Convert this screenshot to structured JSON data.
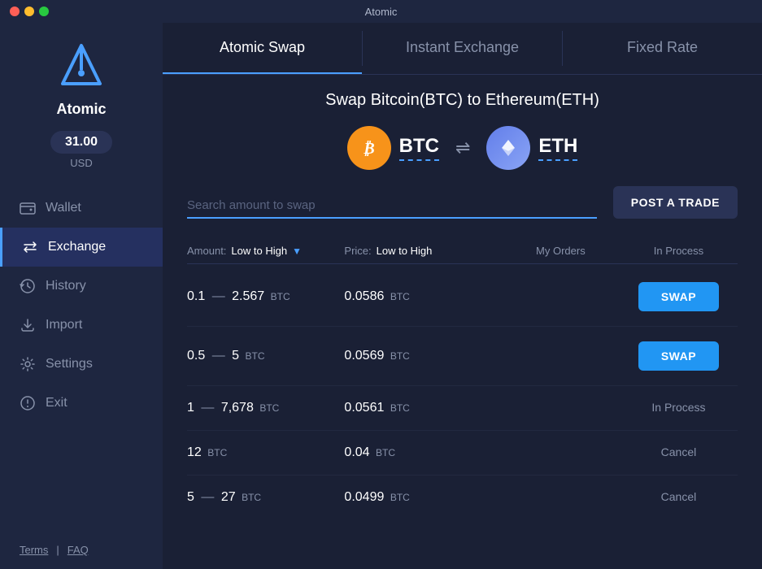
{
  "titlebar": {
    "title": "Atomic"
  },
  "sidebar": {
    "logo_name": "Atomic",
    "balance": "31.00",
    "currency": "USD",
    "nav_items": [
      {
        "id": "wallet",
        "label": "Wallet",
        "icon": "wallet",
        "active": false
      },
      {
        "id": "exchange",
        "label": "Exchange",
        "icon": "exchange",
        "active": true
      },
      {
        "id": "history",
        "label": "History",
        "icon": "history",
        "active": false
      },
      {
        "id": "import",
        "label": "Import",
        "icon": "import",
        "active": false
      },
      {
        "id": "settings",
        "label": "Settings",
        "icon": "settings",
        "active": false
      },
      {
        "id": "exit",
        "label": "Exit",
        "icon": "exit",
        "active": false
      }
    ],
    "footer": {
      "terms_label": "Terms",
      "separator": "|",
      "faq_label": "FAQ"
    }
  },
  "tabs": [
    {
      "id": "atomic-swap",
      "label": "Atomic Swap",
      "active": true
    },
    {
      "id": "instant-exchange",
      "label": "Instant Exchange",
      "active": false
    },
    {
      "id": "fixed-rate",
      "label": "Fixed Rate",
      "active": false
    }
  ],
  "exchange": {
    "swap_title": "Swap Bitcoin(BTC) to Ethereum(ETH)",
    "from_coin": {
      "name": "BTC",
      "symbol": "₿"
    },
    "to_coin": {
      "name": "ETH",
      "symbol": "◆"
    },
    "search_placeholder": "Search amount to swap",
    "post_trade_label": "POST A TRADE",
    "table": {
      "col_amount_label": "Amount:",
      "col_amount_sort": "Low to High",
      "col_price_label": "Price:",
      "col_price_sort": "Low to High",
      "col_myorders": "My Orders",
      "col_inprocess": "In Process",
      "rows": [
        {
          "amount_from": "0.1",
          "amount_dash": "—",
          "amount_to": "2.567",
          "amount_unit": "BTC",
          "price": "0.0586",
          "price_unit": "BTC",
          "action": "swap",
          "action_label": "SWAP"
        },
        {
          "amount_from": "0.5",
          "amount_dash": "—",
          "amount_to": "5",
          "amount_unit": "BTC",
          "price": "0.0569",
          "price_unit": "BTC",
          "action": "swap",
          "action_label": "SWAP"
        },
        {
          "amount_from": "1",
          "amount_dash": "—",
          "amount_to": "7,678",
          "amount_unit": "BTC",
          "price": "0.0561",
          "price_unit": "BTC",
          "action": "in_process",
          "action_label": "In Process"
        },
        {
          "amount_from": "12",
          "amount_dash": "",
          "amount_to": "",
          "amount_unit": "BTC",
          "price": "0.04",
          "price_unit": "BTC",
          "action": "cancel",
          "action_label": "Cancel"
        },
        {
          "amount_from": "5",
          "amount_dash": "—",
          "amount_to": "27",
          "amount_unit": "BTC",
          "price": "0.0499",
          "price_unit": "BTC",
          "action": "cancel",
          "action_label": "Cancel"
        }
      ]
    }
  }
}
